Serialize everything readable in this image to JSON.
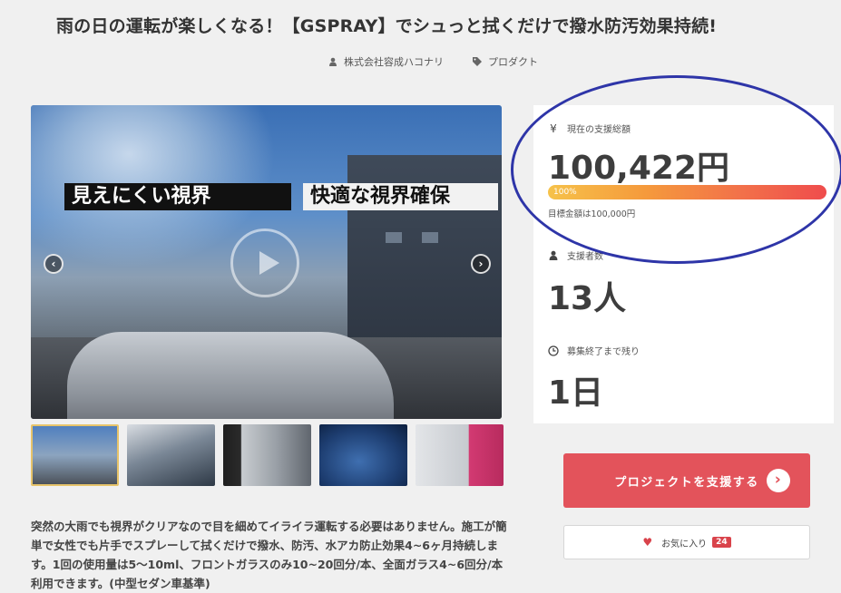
{
  "page": {
    "title": "雨の日の運転が楽しくなる！【GSPRAY】でシュっと拭くだけで撥水防汚効果持続!",
    "author": "株式会社容成ハコナリ",
    "category": "プロダクト"
  },
  "hero": {
    "label_left": "見えにくい視界",
    "label_right": "快適な視界確保",
    "prev": "‹",
    "next": "›"
  },
  "description": "突然の大雨でも視界がクリアなので目を細めてイライラ運転する必要はありません。施工が簡単で女性でも片手でスプレーして拭くだけで撥水、防汚、水アカ防止効果4~6ヶ月持続します。1回の使用量は5〜10ml、フロントガラスのみ10~20回分/本、全面ガラス4~6回分/本利用できます。(中型セダン車基準)",
  "stats": {
    "funding_label": "現在の支援総額",
    "funding_icon": "¥",
    "funding_amount": "100,422円",
    "progress_text": "100%",
    "progress_percent": 100,
    "goal_text": "目標金額は100,000円",
    "supporters_label": "支援者数",
    "supporters_value": "13人",
    "remaining_label": "募集終了まで残り",
    "remaining_value": "1日"
  },
  "actions": {
    "support_label": "プロジェクトを支援する",
    "support_icon": "›",
    "favorite_label": "お気に入り",
    "favorite_count": "24"
  },
  "colors": {
    "support": "#e3535b",
    "annotation": "#2e35a8"
  }
}
